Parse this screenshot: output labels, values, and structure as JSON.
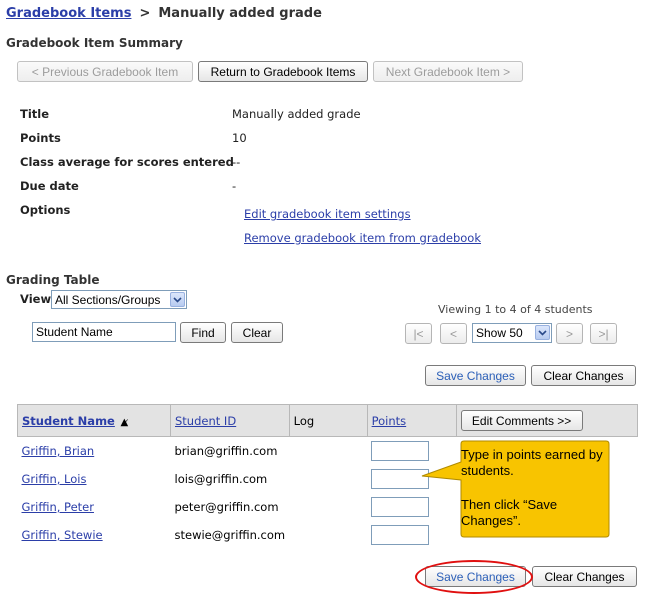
{
  "breadcrumb": {
    "root": "Gradebook Items",
    "separator": ">",
    "current": "Manually added grade"
  },
  "summary": {
    "heading": "Gradebook Item Summary",
    "prev_button": "< Previous Gradebook Item",
    "return_button": "Return to Gradebook Items",
    "next_button": "Next Gradebook Item >",
    "rows": {
      "title_label": "Title",
      "title_value": "Manually added grade",
      "points_label": "Points",
      "points_value": "10",
      "average_label": "Class average for scores entered",
      "average_value": "--",
      "due_label": "Due date",
      "due_value": "-",
      "options_label": "Options"
    },
    "edit_link": "Edit gradebook item settings",
    "remove_link": "Remove gradebook item from gradebook"
  },
  "grading": {
    "heading": "Grading Table",
    "view_label": "View",
    "view_selected": "All Sections/Groups",
    "search_value": "Student Name",
    "find_button": "Find",
    "clear_button": "Clear",
    "viewing_text": "Viewing 1 to 4 of 4 students",
    "first_button": "|<",
    "prev_button": "<",
    "page_size": "Show 50",
    "next_button": ">",
    "last_button": ">|",
    "save_button": "Save Changes",
    "clear_changes_button": "Clear Changes",
    "columns": {
      "name": "Student Name",
      "id": "Student ID",
      "log": "Log",
      "points": "Points",
      "comments_button": "Edit Comments >>"
    },
    "students": [
      {
        "name": "Griffin, Brian",
        "id": "brian@griffin.com"
      },
      {
        "name": "Griffin, Lois",
        "id": "lois@griffin.com"
      },
      {
        "name": "Griffin, Peter",
        "id": "peter@griffin.com"
      },
      {
        "name": "Griffin, Stewie",
        "id": "stewie@griffin.com"
      }
    ]
  },
  "callout": {
    "line1": "Type in points earned by students.",
    "line2": "Then click “Save Changes”."
  },
  "colors": {
    "link": "#2b3ea8",
    "callout_fill": "#f8c400",
    "highlight_ring": "#e01010",
    "table_header": "#e3e3e3"
  }
}
